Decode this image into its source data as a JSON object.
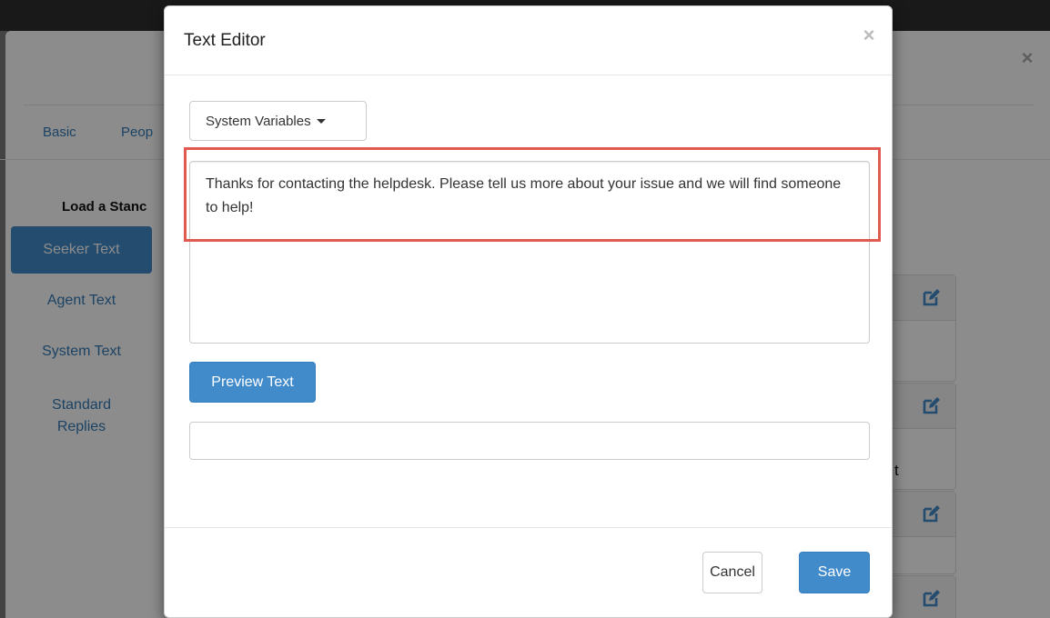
{
  "background": {
    "tabs": [
      "Basic",
      "Peop"
    ],
    "load_label": "Load a Stanc",
    "nav": [
      "Seeker Text",
      "Agent Text",
      "System Text",
      "Standard Replies"
    ],
    "text_fragment": "t"
  },
  "modal": {
    "title": "Text Editor",
    "close_glyph": "×",
    "system_variables_label": "System Variables",
    "editor_text": "Thanks for contacting the helpdesk. Please tell us more about your issue and we will find someone to help!",
    "preview_button": "Preview Text",
    "preview_output": "",
    "cancel_button": "Cancel",
    "save_button": "Save"
  },
  "colors": {
    "primary": "#428bca",
    "highlight": "#e05a50"
  },
  "icons": {
    "edit": "pencil-square-icon",
    "close": "close-icon",
    "caret": "caret-down-icon"
  }
}
